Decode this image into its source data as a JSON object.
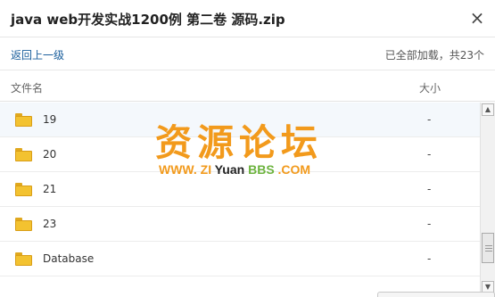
{
  "window": {
    "title": "java web开发实战1200例 第二卷 源码.zip",
    "close_glyph": "×"
  },
  "toolbar": {
    "back_label": "返回上一级",
    "status_text": "已全部加载，共23个"
  },
  "table": {
    "columns": [
      "文件名",
      "大小"
    ],
    "rows": [
      {
        "name": "19",
        "size": "-",
        "icon": "folder-icon"
      },
      {
        "name": "20",
        "size": "-",
        "icon": "folder-icon"
      },
      {
        "name": "21",
        "size": "-",
        "icon": "folder-icon"
      },
      {
        "name": "23",
        "size": "-",
        "icon": "folder-icon"
      },
      {
        "name": "Database",
        "size": "-",
        "icon": "folder-icon"
      }
    ]
  },
  "watermark": {
    "cn": "资源论坛",
    "en_parts": [
      "WWW. ZI ",
      "Yuan ",
      "BBS ",
      ".COM"
    ]
  },
  "colors": {
    "link": "#1a5e9c",
    "folder": "#f3c230",
    "watermark_orange": "#f29a1c",
    "watermark_green": "#6cb33e",
    "selected_row": "#f4f8fc"
  }
}
